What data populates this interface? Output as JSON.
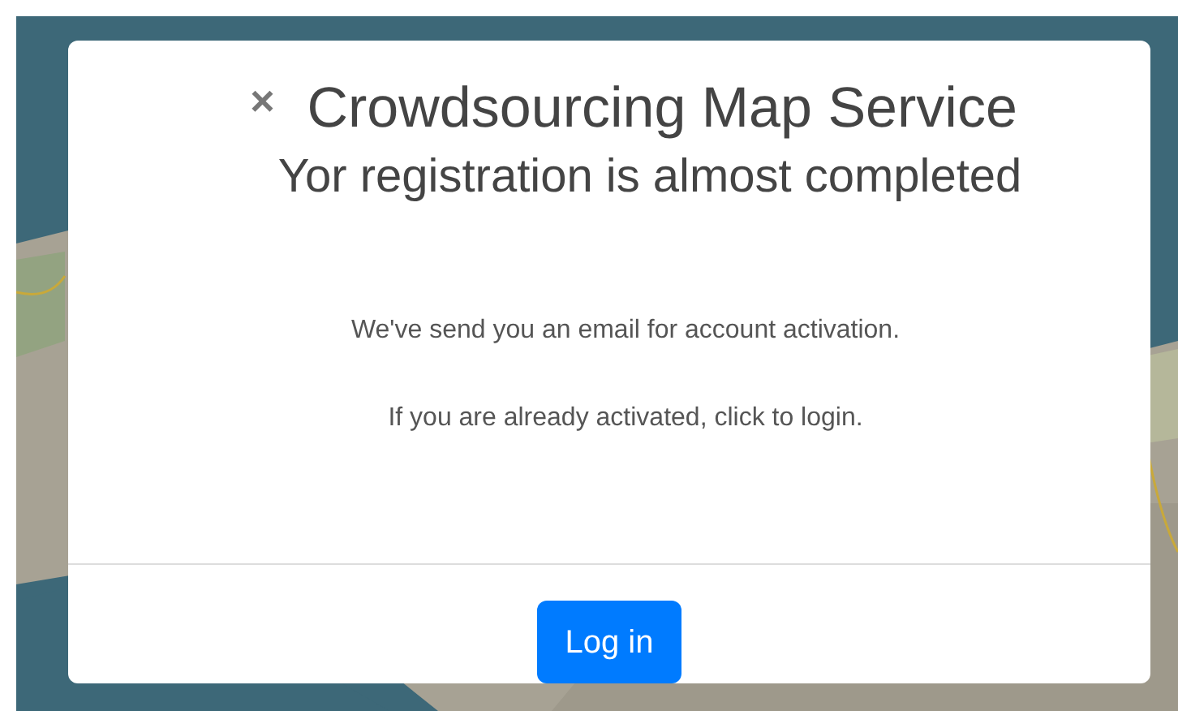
{
  "dialog": {
    "close": "×",
    "title": "Crowdsourcing Map Service",
    "subtitle": "Yor registration is almost completed",
    "messages": [
      "We've send you an email for account activation.",
      "If you are already activated, click to login."
    ],
    "button": "Log in"
  }
}
